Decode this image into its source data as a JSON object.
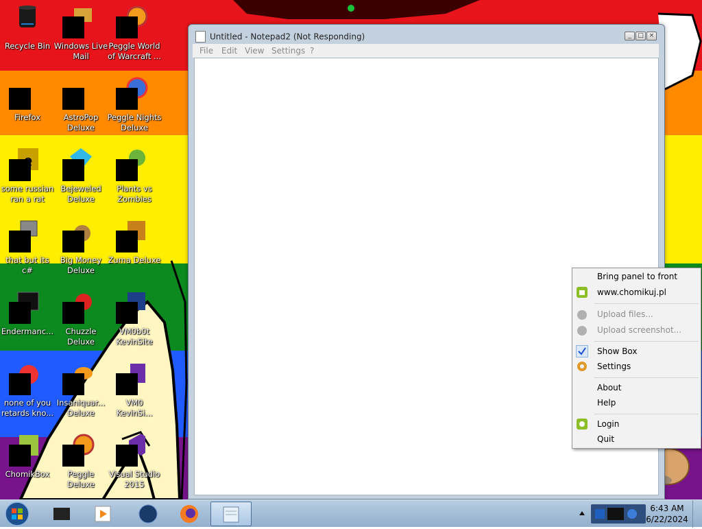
{
  "desktop": {
    "icons": [
      {
        "label": "Recycle Bin"
      },
      {
        "label": "Windows Live Mail"
      },
      {
        "label": "Peggle World of Warcraft ..."
      },
      {
        "label": "Firefox"
      },
      {
        "label": "AstroPop Deluxe"
      },
      {
        "label": "Peggle Nights Deluxe"
      },
      {
        "label": "some russian ran a rat"
      },
      {
        "label": "Bejeweled Deluxe"
      },
      {
        "label": "Plants vs Zombies"
      },
      {
        "label": "that but its c#"
      },
      {
        "label": "Big Money Deluxe"
      },
      {
        "label": "Zuma Deluxe"
      },
      {
        "label": "Endermanc..."
      },
      {
        "label": "Chuzzle Deluxe"
      },
      {
        "label": "VM0b0t KevinSite"
      },
      {
        "label": "none of you retards kno..."
      },
      {
        "label": "Insaniquar... Deluxe"
      },
      {
        "label": "VM0 KevinSi..."
      },
      {
        "label": "ChomikBox"
      },
      {
        "label": "Peggle Deluxe"
      },
      {
        "label": "Visual Studio 2015"
      }
    ]
  },
  "notepad": {
    "title": "Untitled - Notepad2 (Not Responding)",
    "menu": [
      "File",
      "Edit",
      "View",
      "Settings",
      "?"
    ],
    "content": ""
  },
  "context_menu": {
    "items": [
      {
        "label": "Bring panel to front",
        "enabled": true,
        "icon": ""
      },
      {
        "label": "www.chomikuj.pl",
        "enabled": true,
        "icon": "chomik-home-icon"
      },
      {
        "label": "Upload files...",
        "enabled": false,
        "icon": "upload-icon"
      },
      {
        "label": "Upload screenshot...",
        "enabled": false,
        "icon": "upload-icon"
      },
      {
        "label": "Show Box",
        "enabled": true,
        "icon": "checkmark-icon"
      },
      {
        "label": "Settings",
        "enabled": true,
        "icon": "gear-icon"
      },
      {
        "label": "About",
        "enabled": true,
        "icon": ""
      },
      {
        "label": "Help",
        "enabled": true,
        "icon": ""
      },
      {
        "label": "Login",
        "enabled": true,
        "icon": "login-icon"
      },
      {
        "label": "Quit",
        "enabled": true,
        "icon": ""
      }
    ]
  },
  "taskbar": {
    "clock": {
      "time": "6:43 AM",
      "date": "6/22/2024"
    },
    "pinned": [
      "app-icon",
      "media-player-icon",
      "globe-icon",
      "firefox-icon",
      "notepad-icon"
    ]
  },
  "colors": {
    "accent_blue": "#1f5bff",
    "check_blue": "#1b4fd6",
    "chomik_green": "#8cbf26"
  }
}
